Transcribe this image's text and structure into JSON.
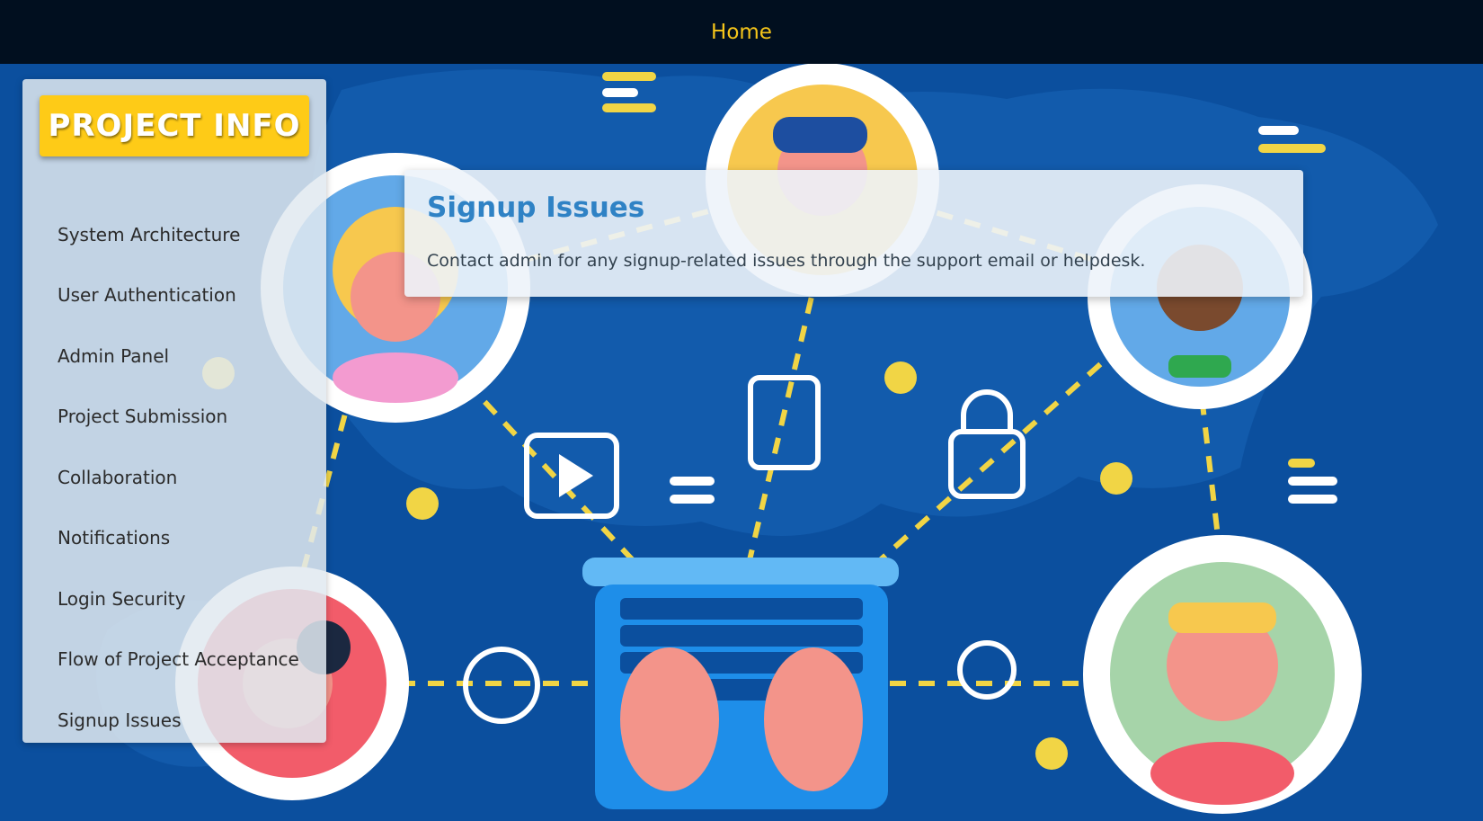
{
  "topbar": {
    "home_label": "Home"
  },
  "sidebar": {
    "brand": "PROJECT INFO",
    "items": [
      {
        "label": "System Architecture"
      },
      {
        "label": "User Authentication"
      },
      {
        "label": "Admin Panel"
      },
      {
        "label": "Project Submission"
      },
      {
        "label": "Collaboration"
      },
      {
        "label": "Notifications"
      },
      {
        "label": "Login Security"
      },
      {
        "label": "Flow of Project Acceptance"
      },
      {
        "label": "Signup Issues"
      }
    ]
  },
  "content": {
    "title": "Signup Issues",
    "body": "Contact admin for any signup-related issues through the support email or helpdesk."
  },
  "colors": {
    "topbar_bg": "#010f1f",
    "home_link": "#f5c51a",
    "brand_bg": "#fecb17",
    "title": "#2f82c5",
    "background": "#0b4f9e"
  }
}
